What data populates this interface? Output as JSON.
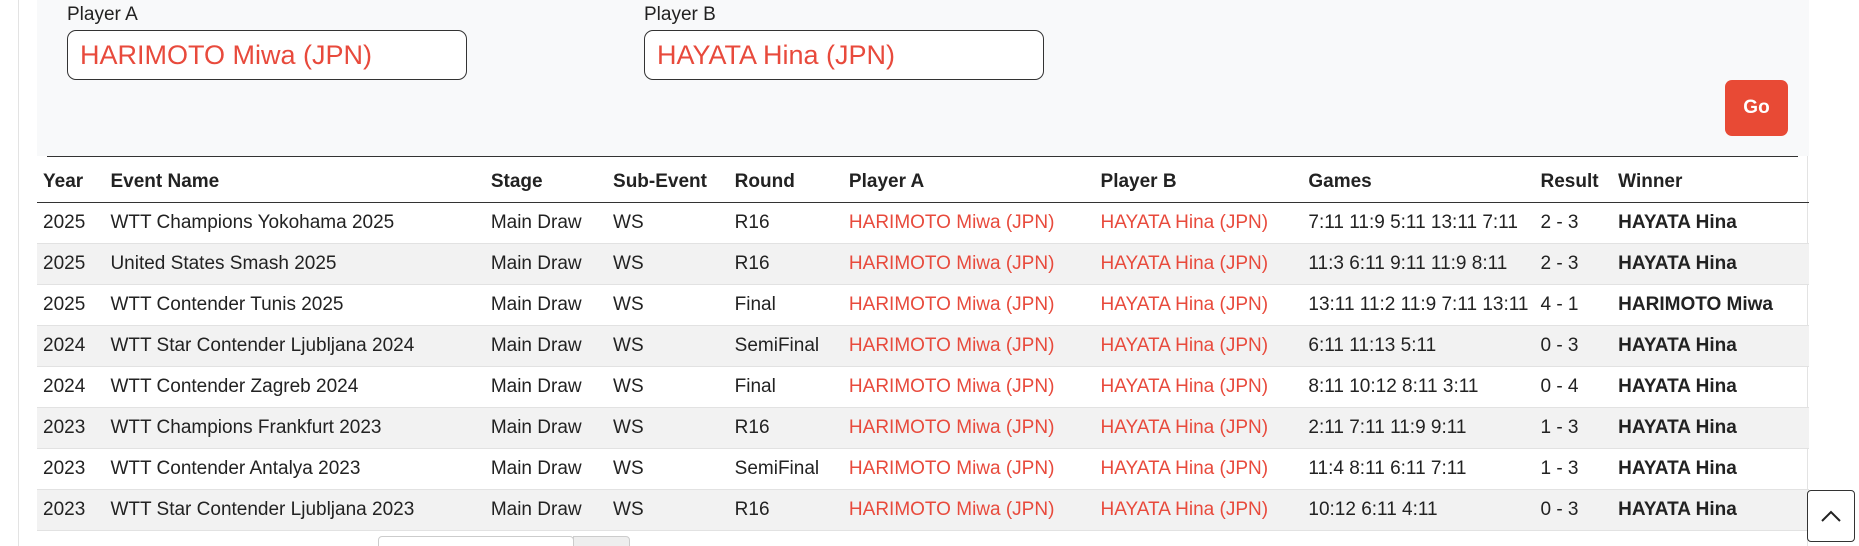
{
  "search": {
    "player_a_label": "Player A",
    "player_a_value": "HARIMOTO Miwa (JPN)",
    "player_b_label": "Player B",
    "player_b_value": "HAYATA Hina (JPN)",
    "go_label": "Go"
  },
  "table": {
    "headers": [
      "Year",
      "Event Name",
      "Stage",
      "Sub-Event",
      "Round",
      "Player A",
      "Player B",
      "Games",
      "Result",
      "Winner"
    ],
    "rows": [
      {
        "year": "2025",
        "event": "WTT Champions Yokohama 2025",
        "stage": "Main Draw",
        "sub_event": "WS",
        "round": "R16",
        "player_a": "HARIMOTO Miwa (JPN)",
        "player_b": "HAYATA Hina (JPN)",
        "games": "7:11 11:9 5:11 13:11 7:11",
        "result": "2 - 3",
        "winner": "HAYATA Hina"
      },
      {
        "year": "2025",
        "event": "United States Smash 2025",
        "stage": "Main Draw",
        "sub_event": "WS",
        "round": "R16",
        "player_a": "HARIMOTO Miwa (JPN)",
        "player_b": "HAYATA Hina (JPN)",
        "games": "11:3 6:11 9:11 11:9 8:11",
        "result": "2 - 3",
        "winner": "HAYATA Hina"
      },
      {
        "year": "2025",
        "event": "WTT Contender Tunis 2025",
        "stage": "Main Draw",
        "sub_event": "WS",
        "round": "Final",
        "player_a": "HARIMOTO Miwa (JPN)",
        "player_b": "HAYATA Hina (JPN)",
        "games": "13:11 11:2 11:9 7:11 13:11",
        "result": "4 - 1",
        "winner": "HARIMOTO Miwa"
      },
      {
        "year": "2024",
        "event": "WTT Star Contender Ljubljana 2024",
        "stage": "Main Draw",
        "sub_event": "WS",
        "round": "SemiFinal",
        "player_a": "HARIMOTO Miwa (JPN)",
        "player_b": "HAYATA Hina (JPN)",
        "games": "6:11 11:13 5:11",
        "result": "0 - 3",
        "winner": "HAYATA Hina"
      },
      {
        "year": "2024",
        "event": "WTT Contender Zagreb 2024",
        "stage": "Main Draw",
        "sub_event": "WS",
        "round": "Final",
        "player_a": "HARIMOTO Miwa (JPN)",
        "player_b": "HAYATA Hina (JPN)",
        "games": "8:11 10:12 8:11 3:11",
        "result": "0 - 4",
        "winner": "HAYATA Hina"
      },
      {
        "year": "2023",
        "event": "WTT Champions Frankfurt 2023",
        "stage": "Main Draw",
        "sub_event": "WS",
        "round": "R16",
        "player_a": "HARIMOTO Miwa (JPN)",
        "player_b": "HAYATA Hina (JPN)",
        "games": "2:11 7:11 11:9 9:11",
        "result": "1 - 3",
        "winner": "HAYATA Hina"
      },
      {
        "year": "2023",
        "event": "WTT Contender Antalya 2023",
        "stage": "Main Draw",
        "sub_event": "WS",
        "round": "SemiFinal",
        "player_a": "HARIMOTO Miwa (JPN)",
        "player_b": "HAYATA Hina (JPN)",
        "games": "11:4 8:11 6:11 7:11",
        "result": "1 - 3",
        "winner": "HAYATA Hina"
      },
      {
        "year": "2023",
        "event": "WTT Star Contender Ljubljana 2023",
        "stage": "Main Draw",
        "sub_event": "WS",
        "round": "R16",
        "player_a": "HARIMOTO Miwa (JPN)",
        "player_b": "HAYATA Hina (JPN)",
        "games": "10:12 6:11 4:11",
        "result": "0 - 3",
        "winner": "HAYATA Hina"
      }
    ]
  },
  "icons": {
    "scroll_top": "chevron-up-icon"
  },
  "colors": {
    "accent": "#e84a35",
    "player_text": "#e84a3c",
    "panel_bg": "#f8f9fa",
    "stripe_bg": "#f2f2f2"
  }
}
